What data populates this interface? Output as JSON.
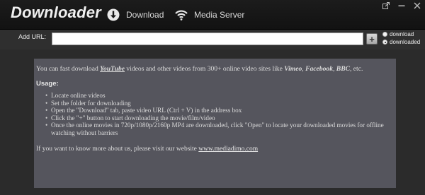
{
  "app": {
    "title": "Downloader"
  },
  "nav": {
    "download_label": "Download",
    "download_icon": "download-icon",
    "media_server_label": "Media Server",
    "media_server_icon": "wifi-icon"
  },
  "window_controls": {
    "icons": [
      "popout-icon",
      "minimize-icon",
      "close-icon"
    ]
  },
  "url_bar": {
    "label": "Add URL:",
    "value": "",
    "add_icon": "plus-icon"
  },
  "view_toggle": {
    "options": [
      "download",
      "downloaded"
    ],
    "selected": "downloaded"
  },
  "info": {
    "intro_before": "You can fast download ",
    "intro_youtube": "YouTube",
    "intro_middle": " videos and other videos from 300+ online video sites like ",
    "site_1": "Vimeo",
    "sep_1": ", ",
    "site_2": "Facebook",
    "sep_2": ", ",
    "site_3": "BBC",
    "intro_after": ", etc.",
    "usage_title": "Usage:",
    "steps": [
      "Locate online videos",
      "Set the folder for downloading",
      "Open the \"Download\" tab, paste video URL (Ctrl + V) in the address box",
      "Click the \"+\" button to start downloading the movie/film/video",
      "Once the online movies in 720p/1080p/2160p MP4 are downloaded, click \"Open\" to locate your downloaded movies for offline watching without barriers"
    ],
    "footer_text": "If you want to know more about us, please visit our website ",
    "website_link": "www.mediadimo.com"
  },
  "colors": {
    "titlebar": "#161616",
    "panel": "#55555d",
    "background": "#2b2b2b"
  }
}
